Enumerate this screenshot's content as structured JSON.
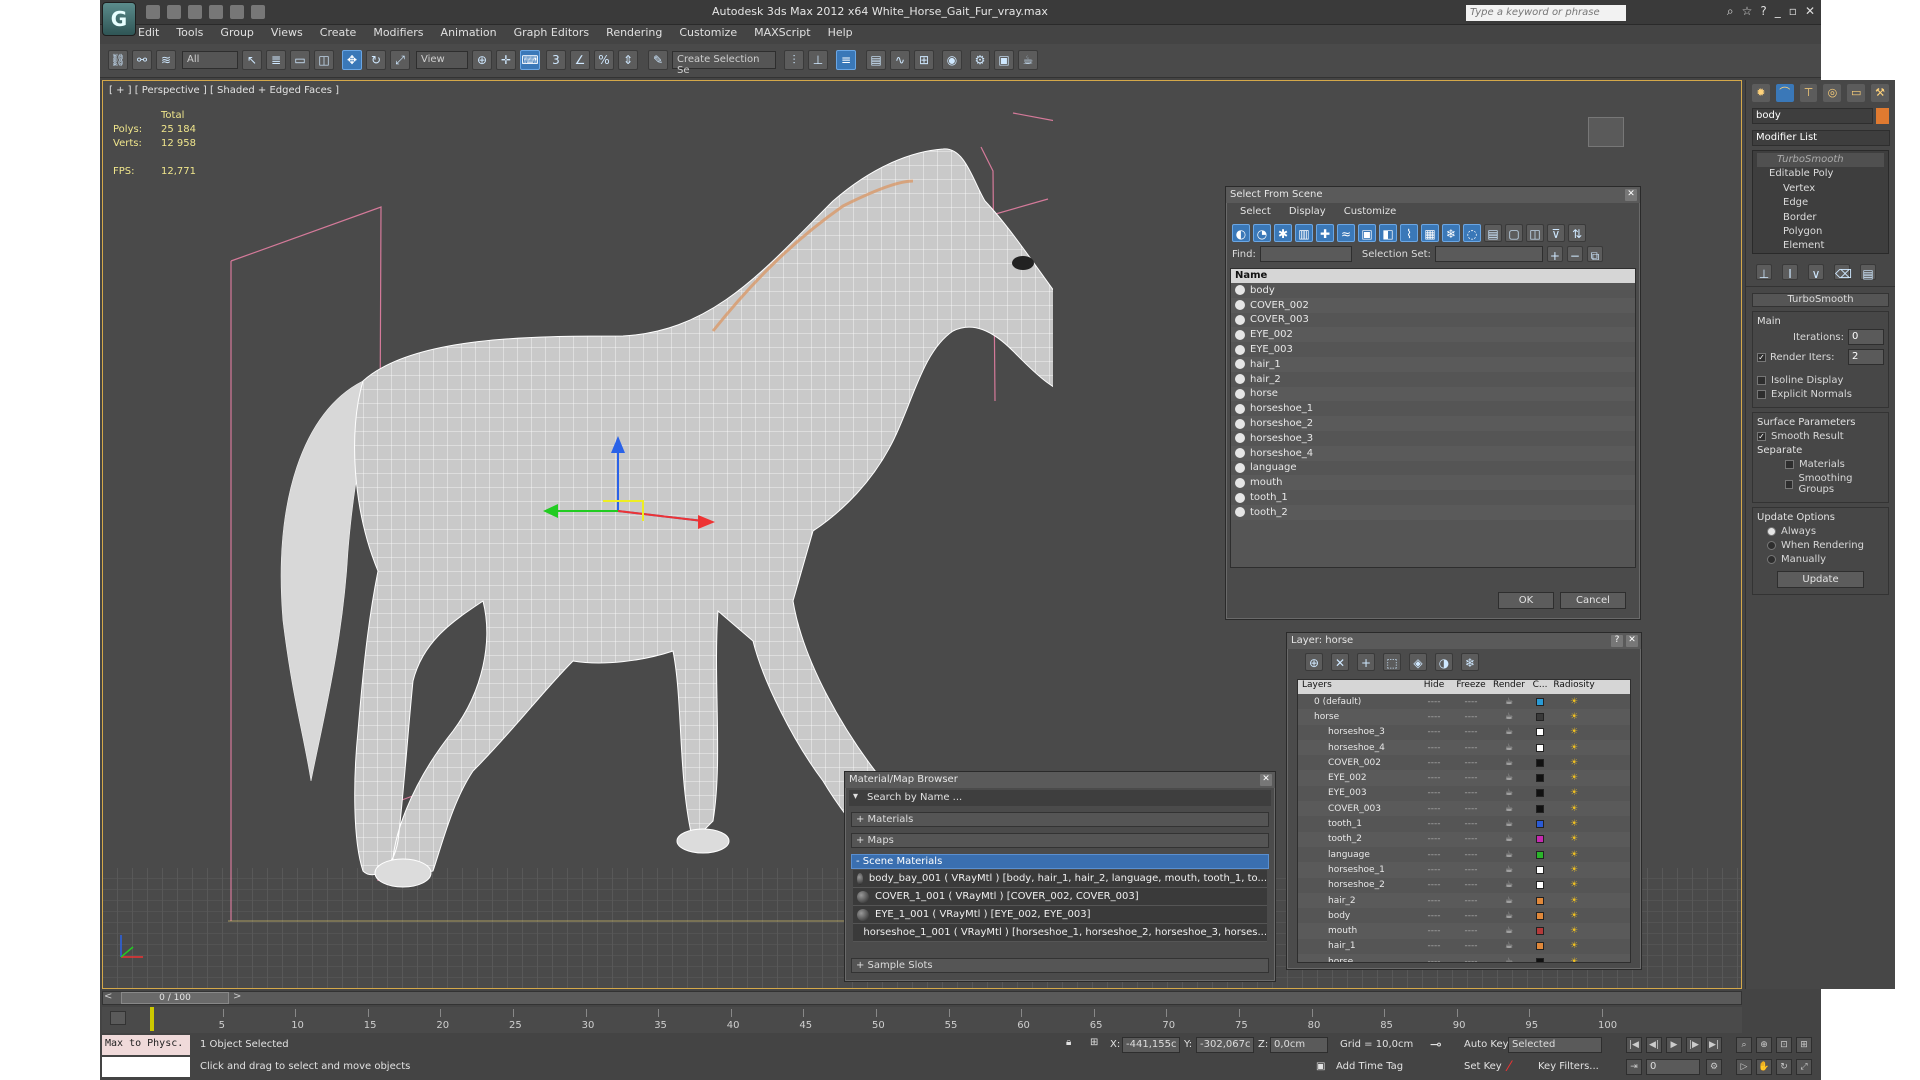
{
  "app": {
    "title": "Autodesk 3ds Max  2012 x64     White_Horse_Gait_Fur_vray.max",
    "search_placeholder": "Type a keyword or phrase",
    "logo": "G",
    "menu": [
      "Edit",
      "Tools",
      "Group",
      "Views",
      "Create",
      "Modifiers",
      "Animation",
      "Graph Editors",
      "Rendering",
      "Customize",
      "MAXScript",
      "Help"
    ]
  },
  "toolbar": {
    "filter": "All",
    "refsys": "View",
    "selection_set": "Create Selection Se"
  },
  "viewport": {
    "label": "[ + ] [ Perspective ] [ Shaded + Edged Faces ]",
    "stats": {
      "total": "Total",
      "polys_label": "Polys:",
      "polys": "25 184",
      "verts_label": "Verts:",
      "verts": "12 958",
      "fps_label": "FPS:",
      "fps": "12,771"
    }
  },
  "select_dialog": {
    "title": "Select From Scene",
    "menu": [
      "Select",
      "Display",
      "Customize"
    ],
    "find_label": "Find:",
    "selset_label": "Selection Set:",
    "column": "Name",
    "items": [
      "body",
      "COVER_002",
      "COVER_003",
      "EYE_002",
      "EYE_003",
      "hair_1",
      "hair_2",
      "horse",
      "horseshoe_1",
      "horseshoe_2",
      "horseshoe_3",
      "horseshoe_4",
      "language",
      "mouth",
      "tooth_1",
      "tooth_2"
    ],
    "ok": "OK",
    "cancel": "Cancel"
  },
  "layer_dialog": {
    "title": "Layer: horse",
    "help": "?",
    "columns": [
      "Layers",
      "Hide",
      "Freeze",
      "Render",
      "C...",
      "Radiosity"
    ],
    "rows": [
      {
        "name": "0 (default)",
        "color": "#2a9ad4"
      },
      {
        "name": "horse",
        "color": "#3a3a3a"
      },
      {
        "name": "horseshoe_3",
        "color": "#ffffff"
      },
      {
        "name": "horseshoe_4",
        "color": "#ffffff"
      },
      {
        "name": "COVER_002",
        "color": "#111111"
      },
      {
        "name": "EYE_002",
        "color": "#111111"
      },
      {
        "name": "EYE_003",
        "color": "#111111"
      },
      {
        "name": "COVER_003",
        "color": "#111111"
      },
      {
        "name": "tooth_1",
        "color": "#2a5ad4"
      },
      {
        "name": "tooth_2",
        "color": "#c42ab0"
      },
      {
        "name": "language",
        "color": "#2ab42a"
      },
      {
        "name": "horseshoe_1",
        "color": "#ffffff"
      },
      {
        "name": "horseshoe_2",
        "color": "#ffffff"
      },
      {
        "name": "hair_2",
        "color": "#e0883a"
      },
      {
        "name": "body",
        "color": "#e0883a"
      },
      {
        "name": "mouth",
        "color": "#b43a3a"
      },
      {
        "name": "hair_1",
        "color": "#e0883a"
      },
      {
        "name": "horse",
        "color": "#111111"
      }
    ],
    "dash": "----"
  },
  "material_browser": {
    "title": "Material/Map Browser",
    "search": "Search by Name ...",
    "sections": [
      "+ Materials",
      "+ Maps"
    ],
    "scene_section": "- Scene Materials",
    "materials": [
      "body_bay_001  ( VRayMtl )  [body, hair_1, hair_2, language, mouth, tooth_1, to...",
      "COVER_1_001  ( VRayMtl )  [COVER_002, COVER_003]",
      "EYE_1_001  ( VRayMtl )  [EYE_002, EYE_003]",
      "horseshoe_1_001  ( VRayMtl )  [horseshoe_1, horseshoe_2, horseshoe_3, horses..."
    ],
    "sample_slots": "+ Sample Slots"
  },
  "command_panel": {
    "object_name": "body",
    "object_color": "#e07a30",
    "modifier_list": "Modifier List",
    "stack": [
      "TurboSmooth",
      "Editable Poly",
      "Vertex",
      "Edge",
      "Border",
      "Polygon",
      "Element"
    ],
    "rollout": "TurboSmooth",
    "main": "Main",
    "iterations_label": "Iterations:",
    "iterations": "0",
    "render_iters_label": "Render Iters:",
    "render_iters": "2",
    "isoline": "Isoline Display",
    "explicit": "Explicit Normals",
    "surface": "Surface Parameters",
    "smooth_result": "Smooth Result",
    "separate": "Separate",
    "materials": "Materials",
    "smoothing_groups": "Smoothing Groups",
    "update_options": "Update Options",
    "always": "Always",
    "when_rendering": "When Rendering",
    "manually": "Manually",
    "update": "Update"
  },
  "timeline": {
    "frame": "0 / 100",
    "ticks": [
      "5",
      "10",
      "15",
      "20",
      "25",
      "30",
      "35",
      "40",
      "45",
      "50",
      "55",
      "60",
      "65",
      "70",
      "75",
      "80",
      "85",
      "90",
      "95",
      "100"
    ]
  },
  "status": {
    "maxscript": "Max to Physc.",
    "selected": "1 Object Selected",
    "prompt": "Click and drag to select and move objects",
    "x_label": "X:",
    "x": "-441,155c",
    "y_label": "Y:",
    "y": "-302,067c",
    "z_label": "Z:",
    "z": "0,0cm",
    "grid": "Grid = 10,0cm",
    "add_time_tag": "Add Time Tag",
    "auto_key": "Auto Key",
    "set_key": "Set Key",
    "selected_dd": "Selected",
    "key_filters": "Key Filters...",
    "frame_field": "0"
  }
}
